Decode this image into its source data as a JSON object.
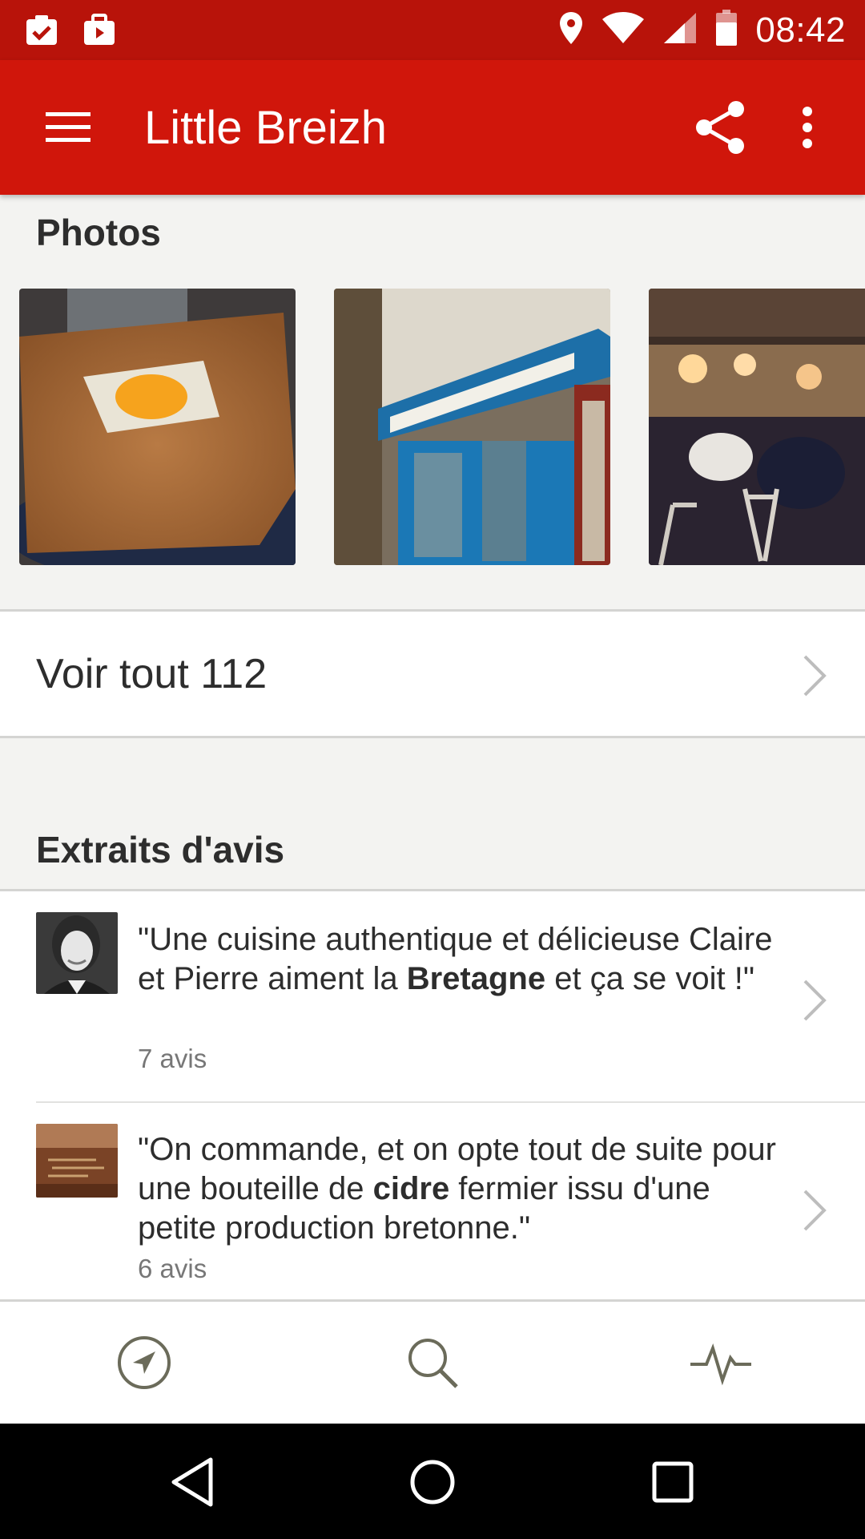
{
  "status_bar": {
    "time": "08:42",
    "icons": [
      "clipboard-check-icon",
      "briefcase-play-icon",
      "location-pin-icon",
      "wifi-icon",
      "cell-signal-icon",
      "battery-icon"
    ]
  },
  "app_bar": {
    "title": "Little Breizh",
    "icons": [
      "menu-icon",
      "share-icon",
      "more-vert-icon"
    ]
  },
  "photos": {
    "title": "Photos",
    "items": [
      "crepe-photo",
      "storefront-photo",
      "dining-room-photo"
    ]
  },
  "see_all": {
    "label": "Voir tout 112"
  },
  "reviews": {
    "title": "Extraits d'avis",
    "items": [
      {
        "quote_before": "\"Une cuisine authentique et délicieuse Claire et Pierre aiment la ",
        "quote_bold": "Bretagne",
        "quote_after": " et ça se voit !\"",
        "count": "7 avis"
      },
      {
        "quote_before": "\"On commande, et on opte tout de suite pour une bouteille de ",
        "quote_bold": "cidre",
        "quote_after": " fermier issu d'une petite production bretonne.\"",
        "count": "6 avis"
      }
    ]
  },
  "bottom_nav": {
    "items": [
      "explore-compass-icon",
      "search-icon",
      "activity-icon"
    ]
  },
  "colors": {
    "status_bar": "#b8130a",
    "app_bar": "#d0160b",
    "background": "#f3f3f1",
    "nav_icon": "#6b6b5a"
  }
}
